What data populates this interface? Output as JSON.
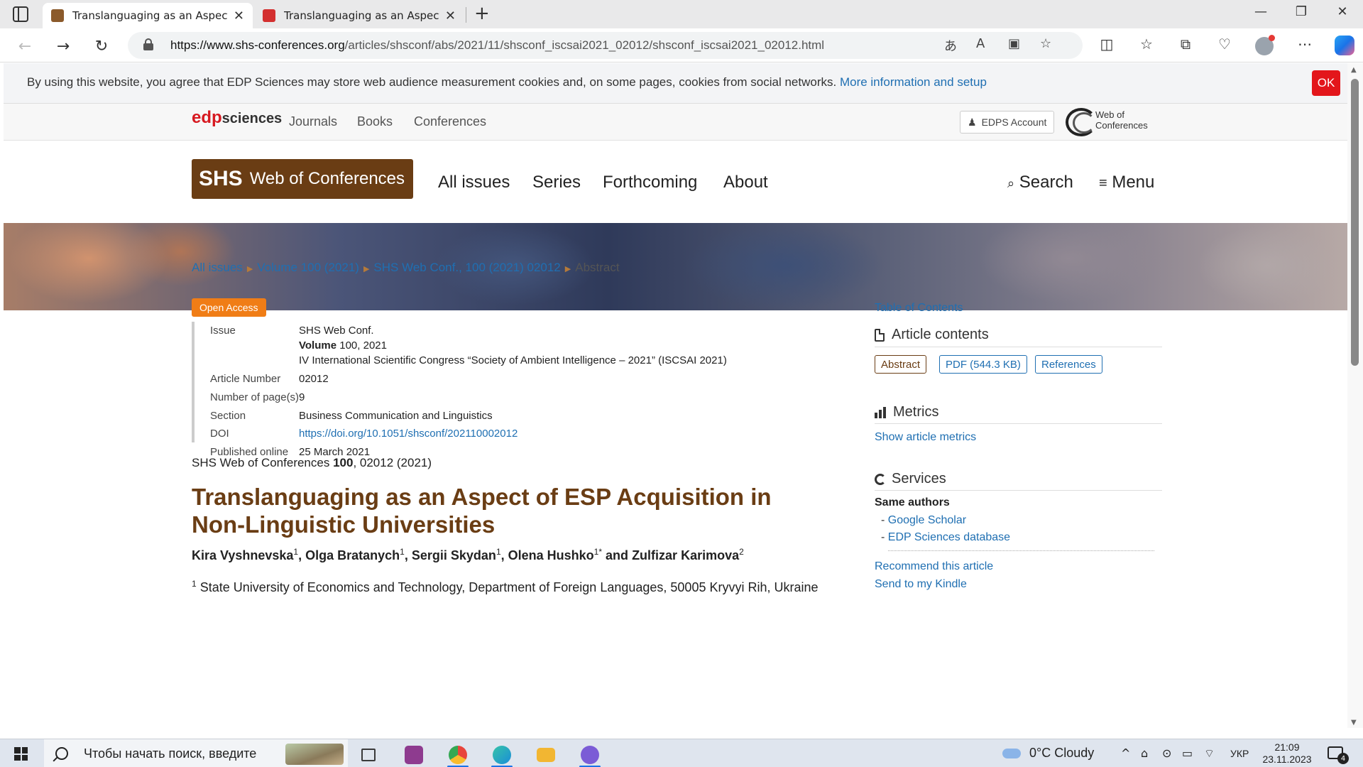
{
  "browser": {
    "tabs": [
      {
        "title": "Translanguaging as an Aspect of",
        "active": true,
        "favicon_color": "#8b5a2b"
      },
      {
        "title": "Translanguaging as an Aspect of",
        "active": false,
        "favicon_color": "#d32f2f"
      }
    ],
    "close_glyph": "✕",
    "new_tab_glyph": "+",
    "window_controls": [
      "—",
      "❐",
      "✕"
    ],
    "nav": {
      "back": "←",
      "forward": "→",
      "reload": "↻"
    },
    "url_host": "https://www.shs-conferences.org",
    "url_path": "/articles/shsconf/abs/2021/11/shsconf_iscsai2021_02012/shsconf_iscsai2021_02012.html",
    "omni_icons": [
      "translate-icon",
      "read-aloud-icon",
      "immersive-reader-icon",
      "favorite-star-icon"
    ],
    "toolbar_icons": [
      "split-screen-icon",
      "favorites-icon",
      "collections-icon",
      "performance-icon",
      "profile-icon",
      "more-icon",
      "copilot-icon"
    ]
  },
  "cookie": {
    "text": "By using this website, you agree that EDP Sciences may store web audience measurement cookies and, on some pages, cookies from social networks.",
    "link": "More information and setup",
    "ok": "OK"
  },
  "edp_bar": {
    "logo_edp": "edp",
    "logo_sciences": "sciences",
    "links": [
      "Journals",
      "Books",
      "Conferences"
    ],
    "account": "EDPS Account",
    "woc_line1": "Web of",
    "woc_line2": "Conferences"
  },
  "header": {
    "logo_shs": "SHS",
    "logo_woc": "Web of Conferences",
    "nav": [
      "All issues",
      "Series",
      "Forthcoming",
      "About"
    ],
    "search": "Search",
    "menu": "Menu"
  },
  "breadcrumb": {
    "items": [
      "All issues",
      "Volume 100 (2021)",
      "SHS Web Conf., 100 (2021) 02012"
    ],
    "current": "Abstract"
  },
  "article": {
    "badge": "Open Access",
    "meta": {
      "issue_label": "Issue",
      "issue_journal": "SHS Web Conf.",
      "issue_volume_label": "Volume",
      "issue_volume": "100, 2021",
      "issue_congress": "IV International Scientific Congress “Society of Ambient Intelligence – 2021” (ISCSAI 2021)",
      "article_number_label": "Article Number",
      "article_number": "02012",
      "pages_label": "Number of page(s)",
      "pages": "9",
      "section_label": "Section",
      "section": "Business Communication and Linguistics",
      "doi_label": "DOI",
      "doi": "https://doi.org/10.1051/shsconf/202110002012",
      "published_label": "Published online",
      "published": "25 March 2021"
    },
    "citation_pre": "SHS Web of Conferences",
    "citation_vol": "100",
    "citation_post": ", 02012 (2021)",
    "title": "Translanguaging as an Aspect of ESP Acquisition in Non-Linguistic Universities",
    "authors": [
      {
        "name": "Kira Vyshnevska",
        "sup": "1"
      },
      {
        "name": "Olga Bratanych",
        "sup": "1"
      },
      {
        "name": "Sergii Skydan",
        "sup": "1"
      },
      {
        "name": "Olena Hushko",
        "sup": "1*"
      },
      {
        "name": "Zulfizar Karimova",
        "sup": "2"
      }
    ],
    "authors_and": "and",
    "affiliation_sup": "1",
    "affiliation": "State University of Economics and Technology, Department of Foreign Languages, 50005 Kryvyi Rih, Ukraine"
  },
  "sidebar": {
    "toc": "Table of Contents",
    "contents_title": "Article contents",
    "buttons": [
      "Abstract",
      "PDF (544.3 KB)",
      "References"
    ],
    "metrics_title": "Metrics",
    "metrics_link": "Show article metrics",
    "services_title": "Services",
    "same_authors": "Same authors",
    "same_authors_links": [
      "Google Scholar",
      "EDP Sciences database"
    ],
    "recommend": "Recommend this article",
    "kindle": "Send to my Kindle"
  },
  "taskbar": {
    "search_placeholder": "Чтобы начать поиск, введите",
    "apps": [
      {
        "name": "task-view",
        "color": "#3a3a3a"
      },
      {
        "name": "winrar",
        "color": "#8e3b8f"
      },
      {
        "name": "chrome",
        "color": "#e8453c"
      },
      {
        "name": "edge",
        "color": "#1a8ed8"
      },
      {
        "name": "file-explorer",
        "color": "#f2b632"
      },
      {
        "name": "viber",
        "color": "#7b5cd6"
      }
    ],
    "weather": "0°C  Cloudy",
    "tray_glyphs": [
      "^",
      "⌂",
      "⊙",
      "▭",
      "⌔"
    ],
    "lang": "УКР",
    "time": "21:09",
    "date": "23.11.2023",
    "notif_count": "4"
  }
}
